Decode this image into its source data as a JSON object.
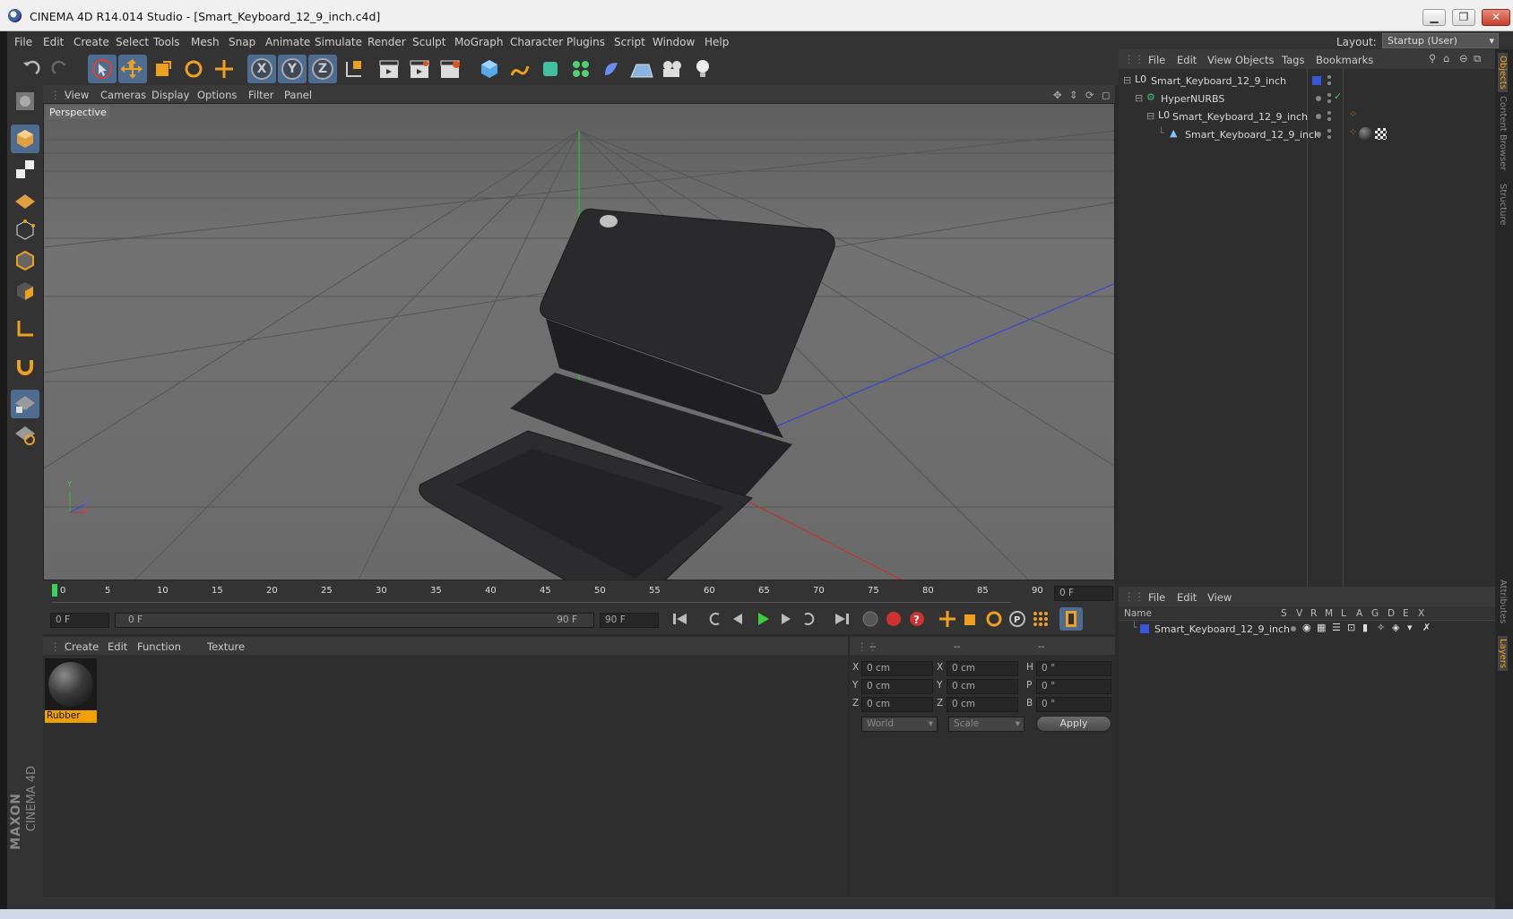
{
  "window": {
    "title": "CINEMA 4D R14.014 Studio - [Smart_Keyboard_12_9_inch.c4d]",
    "buttons": [
      "▁",
      "❐",
      "✕"
    ]
  },
  "menubar": {
    "items": [
      "File",
      "Edit",
      "Create",
      "Select",
      "Tools",
      "Mesh",
      "Snap",
      "Animate",
      "Simulate",
      "Render",
      "Sculpt",
      "MoGraph",
      "Character",
      "Plugins",
      "Script",
      "Window",
      "Help"
    ],
    "layout_label": "Layout:",
    "layout_value": "Startup (User)"
  },
  "viewport": {
    "menu": [
      "View",
      "Cameras",
      "Display",
      "Options",
      "Filter",
      "Panel"
    ],
    "label": "Perspective",
    "axis_labels": {
      "y": "Y",
      "z": "Z",
      "x": "X"
    }
  },
  "timeline": {
    "ticks": [
      "0",
      "5",
      "10",
      "15",
      "20",
      "25",
      "30",
      "35",
      "40",
      "45",
      "50",
      "55",
      "60",
      "65",
      "70",
      "75",
      "80",
      "85",
      "90"
    ],
    "current_frame": "0 F",
    "start_frame": "0 F",
    "range_start": "0 F",
    "range_end": "90 F",
    "end_frame": "90 F"
  },
  "material_panel": {
    "menu": [
      "Create",
      "Edit",
      "Function",
      "Texture"
    ],
    "materials": [
      {
        "name": "Rubber"
      }
    ]
  },
  "coord_panel": {
    "headers": [
      "--",
      "--",
      "--"
    ],
    "rows": [
      {
        "a": "X",
        "av": "0 cm",
        "b": "X",
        "bv": "0 cm",
        "c": "H",
        "cv": "0 °"
      },
      {
        "a": "Y",
        "av": "0 cm",
        "b": "Y",
        "bv": "0 cm",
        "c": "P",
        "cv": "0 °"
      },
      {
        "a": "Z",
        "av": "0 cm",
        "b": "Z",
        "bv": "0 cm",
        "c": "B",
        "cv": "0 °"
      }
    ],
    "mode_select": "World",
    "scale_select": "Scale",
    "apply_label": "Apply"
  },
  "object_manager": {
    "menu": [
      "File",
      "Edit",
      "View",
      "Objects",
      "Tags",
      "Bookmarks"
    ],
    "objects": [
      {
        "name": "Smart_Keyboard_12_9_inch"
      },
      {
        "name": "HyperNURBS"
      },
      {
        "name": "Smart_Keyboard_12_9_inch"
      },
      {
        "name": "Smart_Keyboard_12_9_inch"
      }
    ]
  },
  "layer_manager": {
    "menu": [
      "File",
      "Edit",
      "View"
    ],
    "columns": [
      "Name",
      "S",
      "V",
      "R",
      "M",
      "L",
      "A",
      "G",
      "D",
      "E",
      "X"
    ],
    "layers": [
      {
        "name": "Smart_Keyboard_12_9_inch",
        "color": "#3a55d8"
      }
    ]
  },
  "right_tabs": [
    "Objects",
    "Content Browser",
    "Structure",
    "Attributes",
    "Layers"
  ],
  "branding": {
    "line1": "MAXON",
    "line2": "CINEMA 4D"
  },
  "colors": {
    "accent": "#4d6c8f",
    "material_label": "#f0a000",
    "axis_x": "#c03030",
    "axis_y": "#30c030",
    "axis_z": "#3040d0"
  }
}
